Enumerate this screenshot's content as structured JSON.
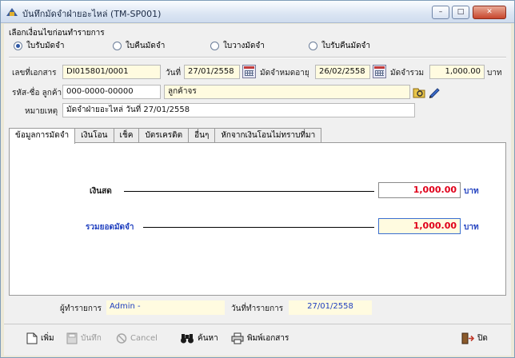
{
  "window": {
    "title": "บันทึกมัดจำฝ่ายอะไหล่ (TM-SP001)",
    "buttons": {
      "minimize": "–",
      "maximize": "□",
      "close": "✕"
    }
  },
  "doc_type": {
    "label": "เลือกเงื่อนไขก่อนทำรายการ",
    "options": [
      "ใบรับมัดจำ",
      "ใบคืนมัดจำ",
      "ใบวางมัดจำ",
      "ใบรับคืนมัดจำ"
    ],
    "selected": "ใบรับมัดจำ"
  },
  "header": {
    "doc_no_label": "เลขที่เอกสาร",
    "doc_no": "DI015801/0001",
    "date_label": "วันที่",
    "date": "27/01/2558",
    "expiry_label": "มัดจำหมดอายุ",
    "expiry": "26/02/2558",
    "total_label": "มัดจำรวม",
    "total": "1,000.00",
    "currency": "บาท",
    "customer_label": "รหัส-ชื่อ ลูกค้า",
    "customer_code": "000-0000-00000",
    "customer_name": "ลูกค้าจร",
    "remark_label": "หมายเหตุ",
    "remark": "มัดจำฝ่ายอะไหล่ วันที่ 27/01/2558"
  },
  "tabs": [
    "ข้อมูลการมัดจำ",
    "เงินโอน",
    "เช็ค",
    "บัตรเครดิต",
    "อื่นๆ",
    "หักจากเงินโอนไม่ทราบที่มา"
  ],
  "payment": {
    "cash_label": "เงินสด",
    "cash_value": "1,000.00",
    "total_label": "รวมยอดมัดจำ",
    "total_value": "1,000.00",
    "unit": "บาท"
  },
  "info": {
    "user_label": "ผู้ทำรายการ",
    "user_value": "Admin -",
    "txn_date_label": "วันที่ทำรายการ",
    "txn_date": "27/01/2558"
  },
  "toolbar": {
    "new": "เพิ่ม",
    "save": "บันทึก",
    "cancel": "Cancel",
    "search": "ค้นหา",
    "print": "พิมพ์เอกสาร",
    "exit": "ปิด"
  },
  "colors": {
    "field_bg": "#fffbe0",
    "cash_value": "#e0001a",
    "total_label": "#1f3fbf",
    "total_value": "#e0001a",
    "info_value": "#1f3fbf"
  }
}
